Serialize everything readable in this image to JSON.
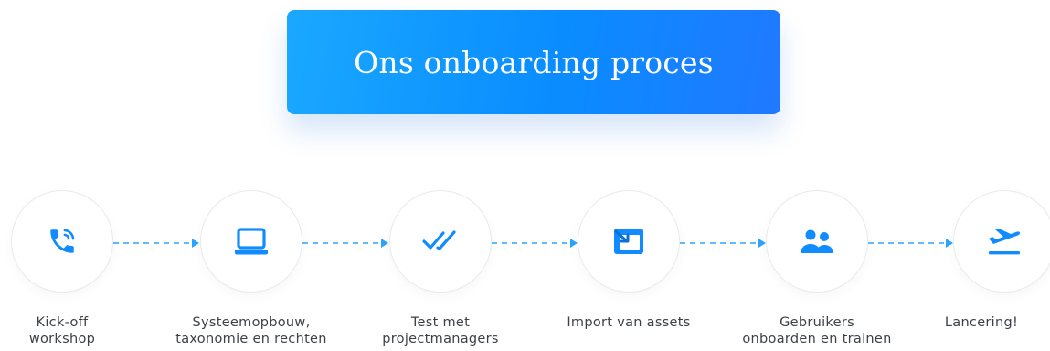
{
  "header": {
    "title": "Ons onboarding proces"
  },
  "accent_color": "#118cff",
  "steps": [
    {
      "icon": "phone-icon",
      "line1": "Kick-off",
      "line2": "workshop"
    },
    {
      "icon": "laptop-icon",
      "line1": "Systeemopbouw,",
      "line2": "taxonomie en rechten"
    },
    {
      "icon": "double-check-icon",
      "line1": "Test met",
      "line2": "projectmanagers"
    },
    {
      "icon": "import-icon",
      "line1": "Import van assets",
      "line2": ""
    },
    {
      "icon": "users-icon",
      "line1": "Gebruikers",
      "line2": "onboarden en trainen"
    },
    {
      "icon": "plane-takeoff-icon",
      "line1": "Lancering!",
      "line2": ""
    }
  ]
}
